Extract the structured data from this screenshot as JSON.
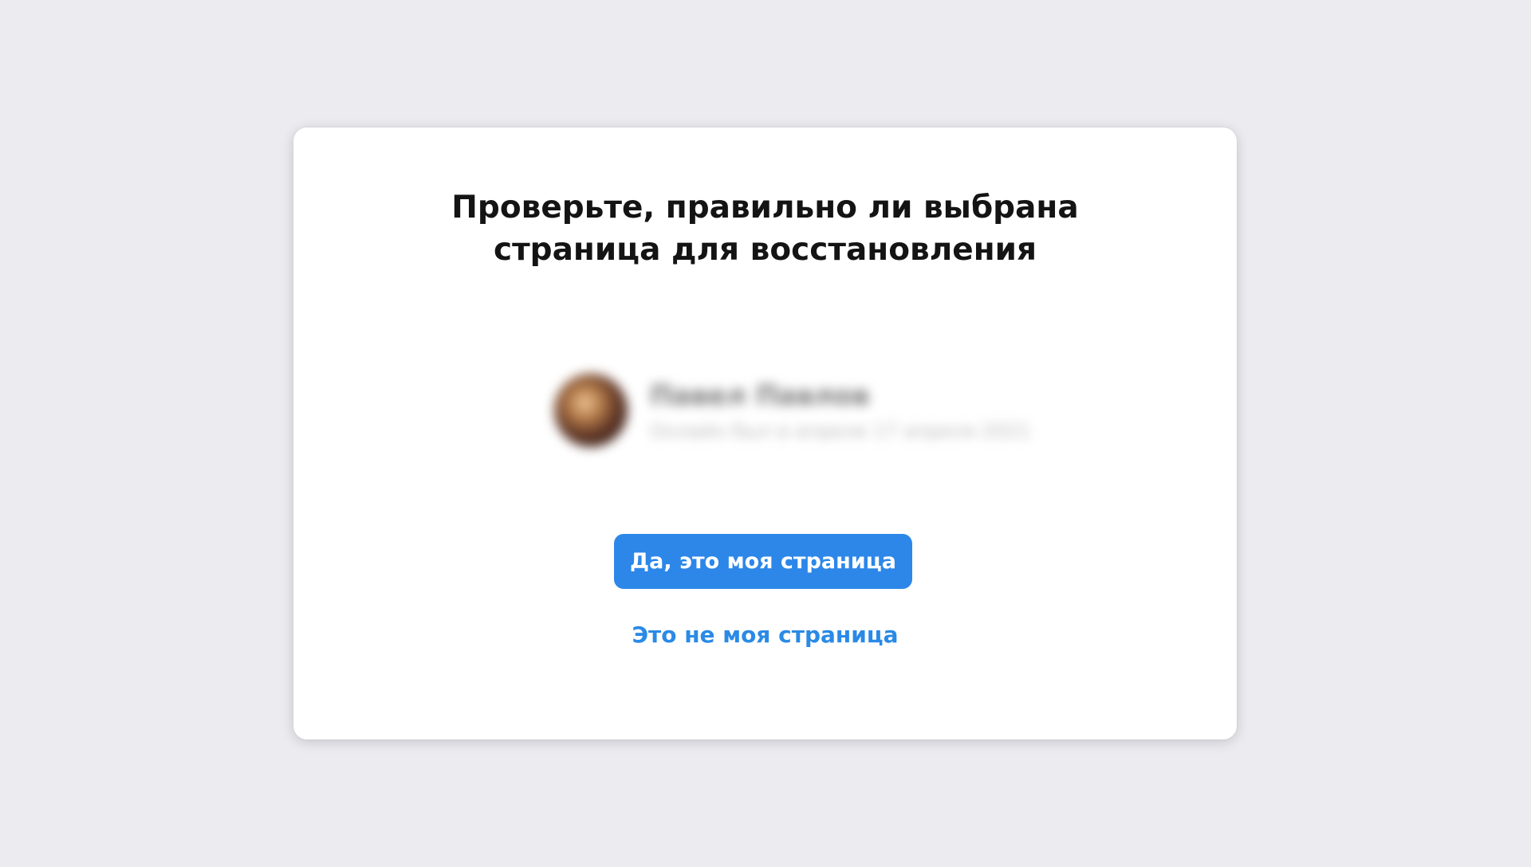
{
  "dialog": {
    "title_line1": "Проверьте, правильно ли выбрана",
    "title_line2": "страница для восстановления",
    "profile": {
      "name": "Павел Павлов",
      "meta": "Онлайн был в апреле 17 апреля 2021"
    },
    "confirm_label": "Да, это моя страница",
    "reject_label": "Это не моя страница"
  },
  "colors": {
    "background": "#ebebf0",
    "card": "#ffffff",
    "primary_button": "#2c87e8",
    "link": "#2a8ae6",
    "title_text": "#141414"
  }
}
